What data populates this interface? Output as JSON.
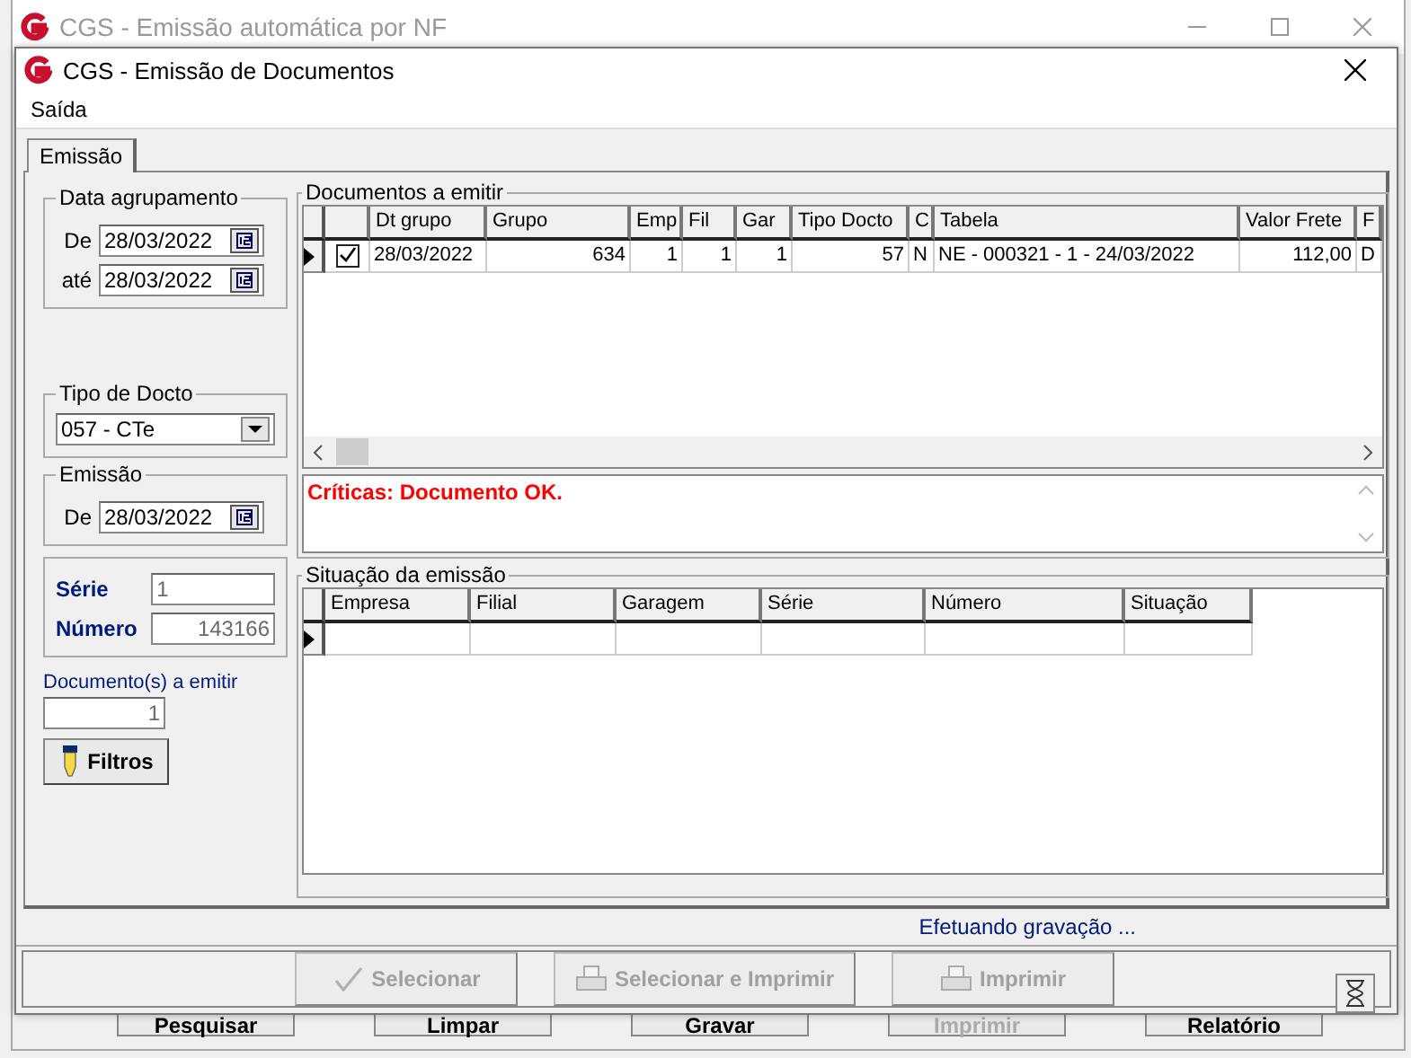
{
  "main_window": {
    "title": "CGS - Emissão automática por NF",
    "buttons": [
      "Pesquisar",
      "Limpar",
      "Gravar",
      "Imprimir",
      "Relatório"
    ]
  },
  "dialog": {
    "title": "CGS - Emissão de Documentos"
  },
  "menu": [
    "Saída"
  ],
  "tabs": [
    {
      "label": "Emissão",
      "selected": true
    }
  ],
  "data_agrupamento": {
    "title": "Data agrupamento",
    "fields": [
      {
        "label": "De",
        "value": "28/03/2022"
      },
      {
        "label": "até",
        "value": "28/03/2022"
      }
    ]
  },
  "tipo_docto": {
    "title": "Tipo de Docto",
    "value": "057 - CTe"
  },
  "emissao": {
    "title": "Emissão",
    "fields": [
      {
        "label": "De",
        "value": "28/03/2022"
      }
    ]
  },
  "serie": {
    "label": "Série",
    "value": "1"
  },
  "numero": {
    "label": "Número",
    "value": "143166"
  },
  "documentos_count": {
    "label": "Documento(s) a emitir",
    "value": "1"
  },
  "filtros_button": "Filtros",
  "documentos": {
    "title": "Documentos a emitir",
    "columns": [
      "",
      "Dt grupo",
      "Grupo",
      "Emp",
      "Fil",
      "Gar",
      "Tipo Docto",
      "C",
      "Tabela",
      "Valor Frete",
      "F"
    ],
    "rows": [
      {
        "current": true,
        "checked": true,
        "cells": [
          "",
          "28/03/2022",
          "634",
          "1",
          "1",
          "1",
          "57",
          "N",
          "NE - 000321 - 1 - 24/03/2022",
          "112,00",
          "D"
        ]
      }
    ]
  },
  "criticas": "Críticas: Documento OK.",
  "situacao": {
    "title": "Situação da emissão",
    "columns": [
      "Empresa",
      "Filial",
      "Garagem",
      "Série",
      "Número",
      "Situação"
    ],
    "rows": [
      {
        "current": true
      }
    ]
  },
  "status": "Efetuando gravação ...",
  "actions": [
    {
      "label": "Selecionar",
      "kind": "check",
      "disabled": true
    },
    {
      "label": "Selecionar e Imprimir",
      "kind": "printer",
      "disabled": true
    },
    {
      "label": "Imprimir",
      "kind": "printer",
      "disabled": true
    }
  ]
}
